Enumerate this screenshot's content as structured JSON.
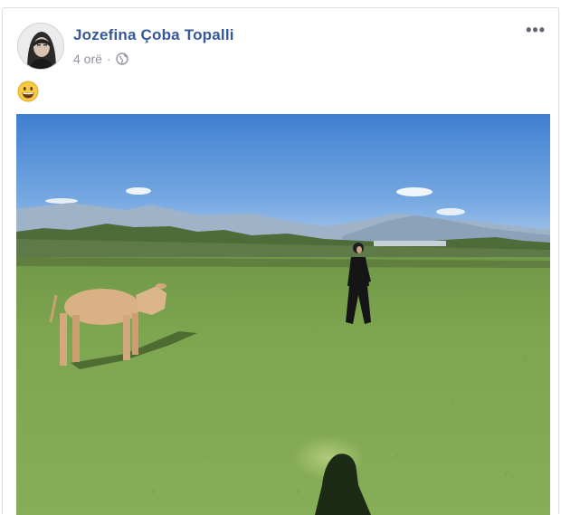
{
  "post": {
    "author_name": "Jozefina Çoba Topalli",
    "timestamp": "4 orë",
    "separator": "·",
    "privacy_icon": "globe-icon",
    "more_label": "•••",
    "body_emoji": "grinning-face-with-big-eyes-emoji",
    "photo": "photo of a woman standing in a grassy field facing a calf, mountains on the horizon, photographer's shadow in foreground"
  },
  "colors": {
    "author_link": "#365899",
    "meta_text": "#90949c",
    "card_border": "#dddfe2"
  }
}
